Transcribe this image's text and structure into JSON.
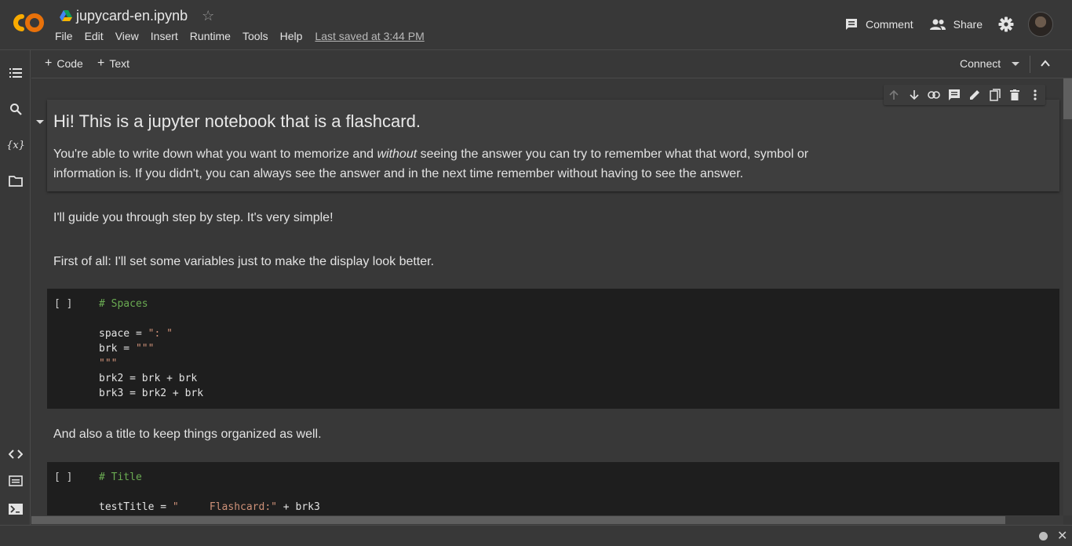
{
  "header": {
    "notebook_title": "jupycard-en.ipynb",
    "menu": [
      "File",
      "Edit",
      "View",
      "Insert",
      "Runtime",
      "Tools",
      "Help"
    ],
    "last_saved": "Last saved at 3:44 PM",
    "comment_label": "Comment",
    "share_label": "Share"
  },
  "toolbar": {
    "add_code": "Code",
    "add_text": "Text",
    "connect_label": "Connect"
  },
  "cells": {
    "title_heading": "Hi! This is a jupyter notebook that is a flashcard.",
    "intro_pre": "You're able to write down what you want to memorize and ",
    "intro_em": "without",
    "intro_post": " seeing the answer you can try to remember what that word, symbol or",
    "intro_line2": "information is. If you didn't, you can always see the answer and in the next time remember without having to see the answer.",
    "guide_text": "I'll guide you through step by step. It's very simple!",
    "first_text": "First of all: I'll set some variables just to make the display look better.",
    "code1": {
      "run": "[ ]",
      "comment": "# Spaces",
      "l1a": "space = ",
      "l1s": "\": \"",
      "l2a": "brk = ",
      "l2s": "\"\"\"",
      "l3s": "\"\"\"",
      "l4": "brk2 = brk + brk",
      "l5": "brk3 = brk2 + brk"
    },
    "title_text": "And also a title to keep things organized as well.",
    "code2": {
      "run": "[ ]",
      "comment": "# Title",
      "l1a": "testTitle = ",
      "l1s": "\"     Flashcard:\"",
      "l1b": " + brk3"
    }
  },
  "colors": {
    "background": "#383838",
    "code_bg": "#1e1e1e",
    "comment": "#6aab52",
    "string": "#ce9178",
    "logo_orange": "#f9ab00"
  }
}
